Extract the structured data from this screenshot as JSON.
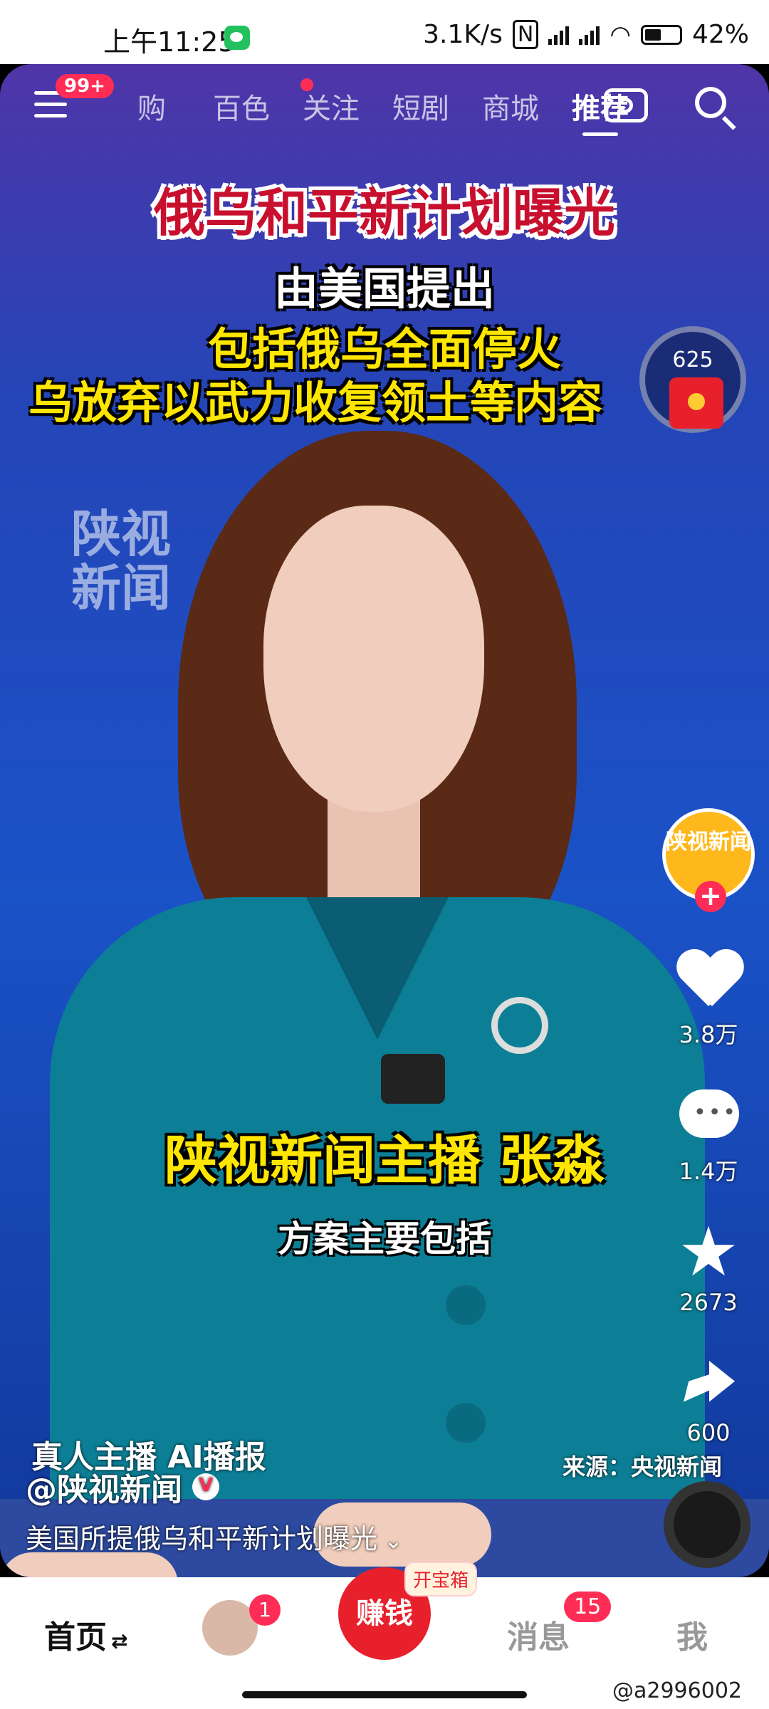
{
  "status_bar": {
    "time": "上午11:25",
    "net_speed": "3.1K/s",
    "battery": "42%",
    "icons": [
      "wechat-icon",
      "nfc-icon",
      "signal-icon",
      "wifi-icon",
      "battery-icon"
    ]
  },
  "top_nav": {
    "menu_badge": "99+",
    "tabs": [
      {
        "label": "购"
      },
      {
        "label": "百色"
      },
      {
        "label": "关注"
      },
      {
        "label": "短剧"
      },
      {
        "label": "商城"
      },
      {
        "label": "推荐"
      }
    ],
    "active_tab": "推荐"
  },
  "video": {
    "headline": "俄乌和平新计划曝光",
    "caption_2": "由美国提出",
    "caption_3": "包括俄乌全面停火",
    "caption_4": "乌放弃以武力收复领土等内容",
    "watermark": "陕视新闻",
    "red_packet_count": "625",
    "name_caption": "陕视新闻主播 张淼",
    "subtitle": "方案主要包括",
    "ai_label": "真人主播 AI播报",
    "source": "来源：央视新闻",
    "author": "@陕视新闻",
    "description": "美国所提俄乌和平新计划曝光"
  },
  "sidebar": {
    "avatar_text": "陕视新闻",
    "likes": "3.8万",
    "comments": "1.4万",
    "favorites": "2673",
    "shares": "600"
  },
  "bottom_nav": {
    "home": "首页",
    "home_indicator": "⇄",
    "friends_badge": "1",
    "earn": "赚钱",
    "treasure": "开宝箱",
    "messages": "消息",
    "messages_badge": "15",
    "me": "我"
  },
  "weibo_watermark": "@a2996002"
}
